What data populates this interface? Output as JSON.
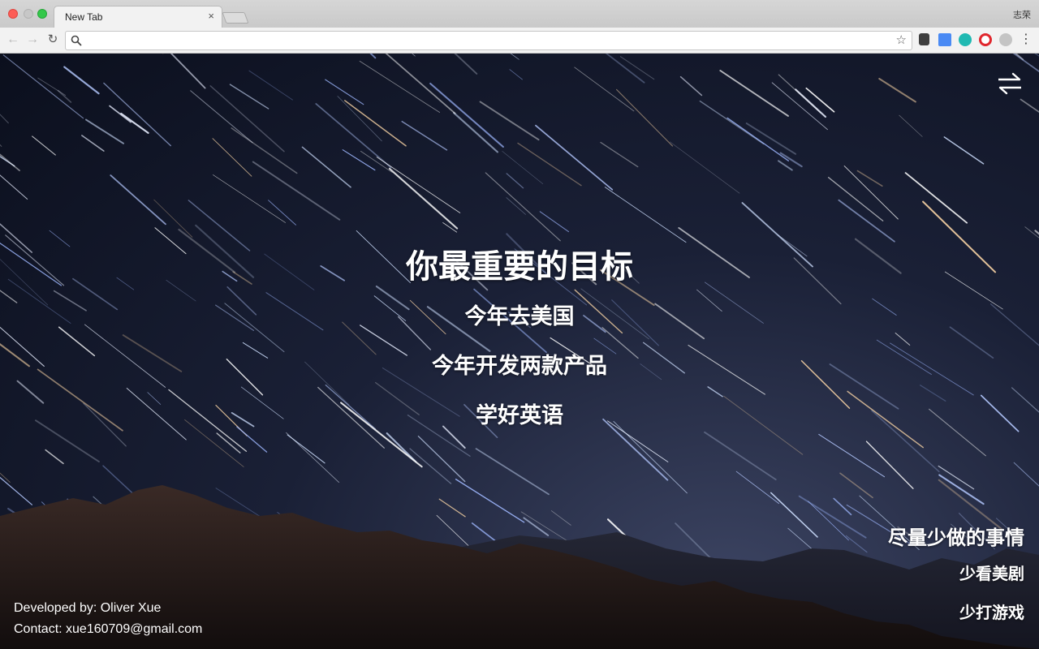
{
  "browser": {
    "tab_title": "New Tab",
    "tab_close": "×",
    "profile_name": "志荣",
    "omnibox_value": "",
    "extensions": [
      "evernote-icon",
      "google-translate-icon",
      "teal-extension-icon",
      "opera-icon",
      "gray-extension-icon"
    ]
  },
  "goals": {
    "heading": "你最重要的目标",
    "items": [
      "今年去美国",
      "今年开发两款产品",
      "学好英语"
    ]
  },
  "avoid": {
    "heading": "尽量少做的事情",
    "items": [
      "少看美剧",
      "少打游戏"
    ]
  },
  "credits": {
    "developer": "Developed by: Oliver Xue",
    "contact": "Contact: xue160709@gmail.com"
  },
  "colors": {
    "sky_dark": "#0b0f1d",
    "sky_light": "#3c4462",
    "mountain": "#2a1f1d",
    "text": "#ffffff"
  }
}
